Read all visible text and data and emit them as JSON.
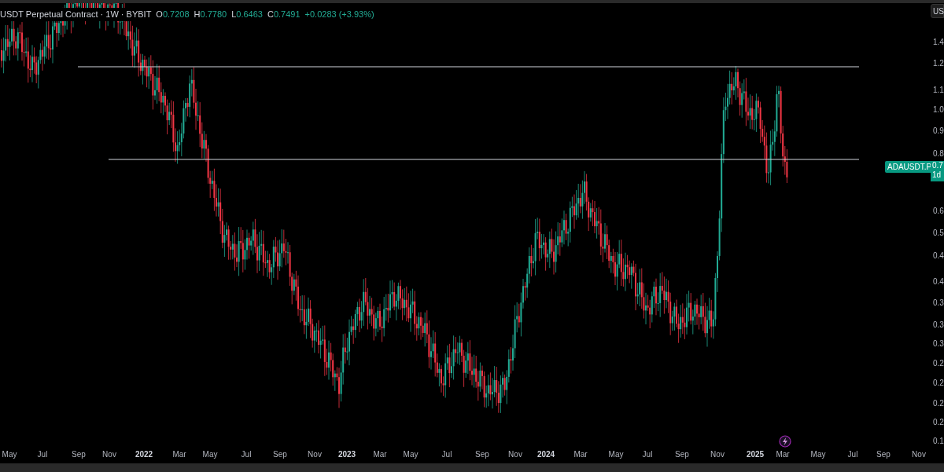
{
  "legend": {
    "title": "USDT Perpetual Contract · 1W · BYBIT",
    "ohlc": [
      {
        "label": "O",
        "value": "0.7208"
      },
      {
        "label": "H",
        "value": "0.7780"
      },
      {
        "label": "L",
        "value": "0.6463"
      },
      {
        "label": "C",
        "value": "0.7491"
      }
    ],
    "change": "+0.0283 (+3.93%)"
  },
  "currency_button": "US",
  "price_axis": [
    "1.4",
    "1.2",
    "1.1",
    "1.0",
    "0.9",
    "0.8",
    "0.6",
    "0.5",
    "0.4",
    "0.4",
    "0.3",
    "0.3",
    "0.3",
    "0.2",
    "0.2",
    "0.2",
    "0.2",
    "0.1"
  ],
  "price_tag": {
    "symbol": "ADAUSDT.P",
    "price": "0.7",
    "countdown": "1d"
  },
  "time_axis": [
    {
      "text": "May",
      "kind": "month"
    },
    {
      "text": "Jul",
      "kind": "month"
    },
    {
      "text": "Sep",
      "kind": "month"
    },
    {
      "text": "Nov",
      "kind": "month"
    },
    {
      "text": "2022",
      "kind": "year"
    },
    {
      "text": "Mar",
      "kind": "month"
    },
    {
      "text": "May",
      "kind": "month"
    },
    {
      "text": "Jul",
      "kind": "month"
    },
    {
      "text": "Sep",
      "kind": "month"
    },
    {
      "text": "Nov",
      "kind": "month"
    },
    {
      "text": "2023",
      "kind": "year"
    },
    {
      "text": "Mar",
      "kind": "month"
    },
    {
      "text": "May",
      "kind": "month"
    },
    {
      "text": "Jul",
      "kind": "month"
    },
    {
      "text": "Sep",
      "kind": "month"
    },
    {
      "text": "Nov",
      "kind": "month"
    },
    {
      "text": "2024",
      "kind": "year"
    },
    {
      "text": "Mar",
      "kind": "month"
    },
    {
      "text": "May",
      "kind": "month"
    },
    {
      "text": "Jul",
      "kind": "month"
    },
    {
      "text": "Sep",
      "kind": "month"
    },
    {
      "text": "Nov",
      "kind": "month"
    },
    {
      "text": "2025",
      "kind": "year"
    },
    {
      "text": "Mar",
      "kind": "month"
    },
    {
      "text": "May",
      "kind": "month"
    },
    {
      "text": "Jul",
      "kind": "month"
    },
    {
      "text": "Sep",
      "kind": "month"
    },
    {
      "text": "Nov",
      "kind": "month"
    }
  ]
}
